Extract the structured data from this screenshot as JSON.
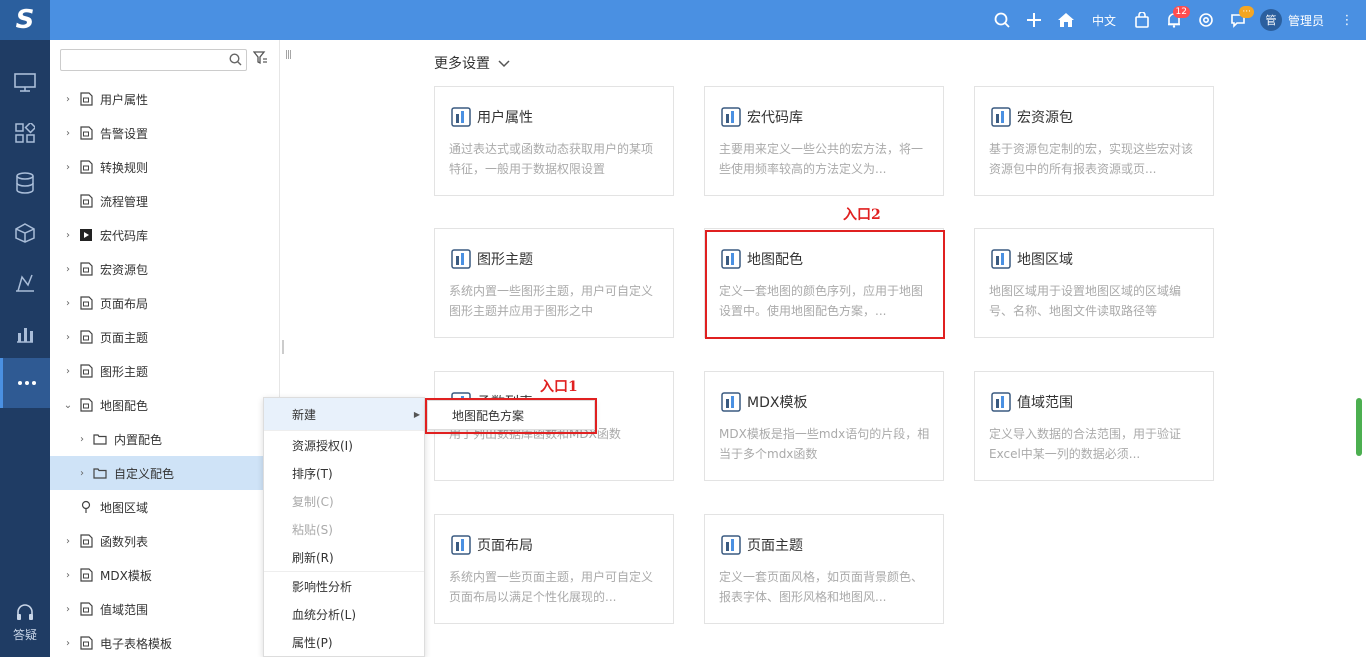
{
  "topbar": {
    "logo": "S",
    "lang": "中文",
    "notify_count": "12",
    "chat_badge": "···",
    "avatar": "管",
    "user": "管理员"
  },
  "rail": {
    "help_label": "答疑"
  },
  "tree": {
    "search_placeholder": "",
    "items": [
      {
        "label": "用户属性",
        "caret": "›",
        "icon": "user-attr-icon"
      },
      {
        "label": "告警设置",
        "caret": "›",
        "icon": "alert-icon"
      },
      {
        "label": "转换规则",
        "caret": "›",
        "icon": "convert-icon"
      },
      {
        "label": "流程管理",
        "caret": "",
        "icon": "flow-icon"
      },
      {
        "label": "宏代码库",
        "caret": "›",
        "icon": "macro-icon"
      },
      {
        "label": "宏资源包",
        "caret": "›",
        "icon": "package-icon"
      },
      {
        "label": "页面布局",
        "caret": "›",
        "icon": "layout-icon"
      },
      {
        "label": "页面主题",
        "caret": "›",
        "icon": "theme-icon"
      },
      {
        "label": "图形主题",
        "caret": "›",
        "icon": "chart-theme-icon"
      },
      {
        "label": "地图配色",
        "caret": "⌄",
        "icon": "map-color-icon"
      },
      {
        "label": "内置配色",
        "caret": "›",
        "icon": "folder-icon"
      },
      {
        "label": "自定义配色",
        "caret": "›",
        "icon": "folder-icon"
      },
      {
        "label": "地图区域",
        "caret": "",
        "icon": "pin-icon"
      },
      {
        "label": "函数列表",
        "caret": "›",
        "icon": "function-icon"
      },
      {
        "label": "MDX模板",
        "caret": "›",
        "icon": "mdx-icon"
      },
      {
        "label": "值域范围",
        "caret": "›",
        "icon": "range-icon"
      },
      {
        "label": "电子表格模板",
        "caret": "›",
        "icon": "sheet-icon"
      }
    ]
  },
  "main": {
    "more_settings": "更多设置",
    "cards": [
      {
        "title": "用户属性",
        "desc": "通过表达式或函数动态获取用户的某项特征，一般用于数据权限设置",
        "icon": "user-info-icon"
      },
      {
        "title": "宏代码库",
        "desc": "主要用来定义一些公共的宏方法，将一些使用频率较高的方法定义为...",
        "icon": "macro-play-icon"
      },
      {
        "title": "宏资源包",
        "desc": "基于资源包定制的宏，实现这些宏对该资源包中的所有报表资源或页...",
        "icon": "toolbox-icon"
      },
      {
        "title": "图形主题",
        "desc": "系统内置一些图形主题，用户可自定义图形主题并应用于图形之中",
        "icon": "bar-chart-icon"
      },
      {
        "title": "地图配色",
        "desc": "定义一套地图的颜色序列，应用于地图设置中。使用地图配色方案，...",
        "icon": "map-palette-icon"
      },
      {
        "title": "地图区域",
        "desc": "地图区域用于设置地图区域的区域编号、名称、地图文件读取路径等",
        "icon": "map-region-icon"
      },
      {
        "title": "函数列表",
        "desc": "用于列出数据库函数和MDX函数",
        "icon": "function-doc-icon"
      },
      {
        "title": "MDX模板",
        "desc": "MDX模板是指一些mdx语句的片段，相当于多个mdx函数",
        "icon": "mdx-box-icon"
      },
      {
        "title": "值域范围",
        "desc": "定义导入数据的合法范围，用于验证Excel中某一列的数据必须...",
        "icon": "range-doc-icon"
      },
      {
        "title": "页面布局",
        "desc": "系统内置一些页面主题，用户可自定义页面布局以满足个性化展现的...",
        "icon": "page-layout-icon"
      },
      {
        "title": "页面主题",
        "desc": "定义一套页面风格，如页面背景颜色、报表字体、图形风格和地图风...",
        "icon": "page-theme-icon"
      }
    ]
  },
  "annotations": {
    "entry1": "入口1",
    "entry2": "入口2"
  },
  "context_menu": {
    "items": [
      {
        "label": "新建",
        "disabled": false
      },
      {
        "label": "资源授权(I)",
        "disabled": false
      },
      {
        "label": "排序(T)",
        "disabled": false
      },
      {
        "label": "复制(C)",
        "disabled": true
      },
      {
        "label": "粘贴(S)",
        "disabled": true
      },
      {
        "label": "刷新(R)",
        "disabled": false
      },
      {
        "label": "影响性分析",
        "disabled": false
      },
      {
        "label": "血统分析(L)",
        "disabled": false
      },
      {
        "label": "属性(P)",
        "disabled": false
      }
    ],
    "submenu_item": "地图配色方案"
  },
  "colors": {
    "topbar": "#4a90e2",
    "rail": "#1f3c64",
    "highlight": "#e02020",
    "selected_row": "#cfe3f7"
  }
}
